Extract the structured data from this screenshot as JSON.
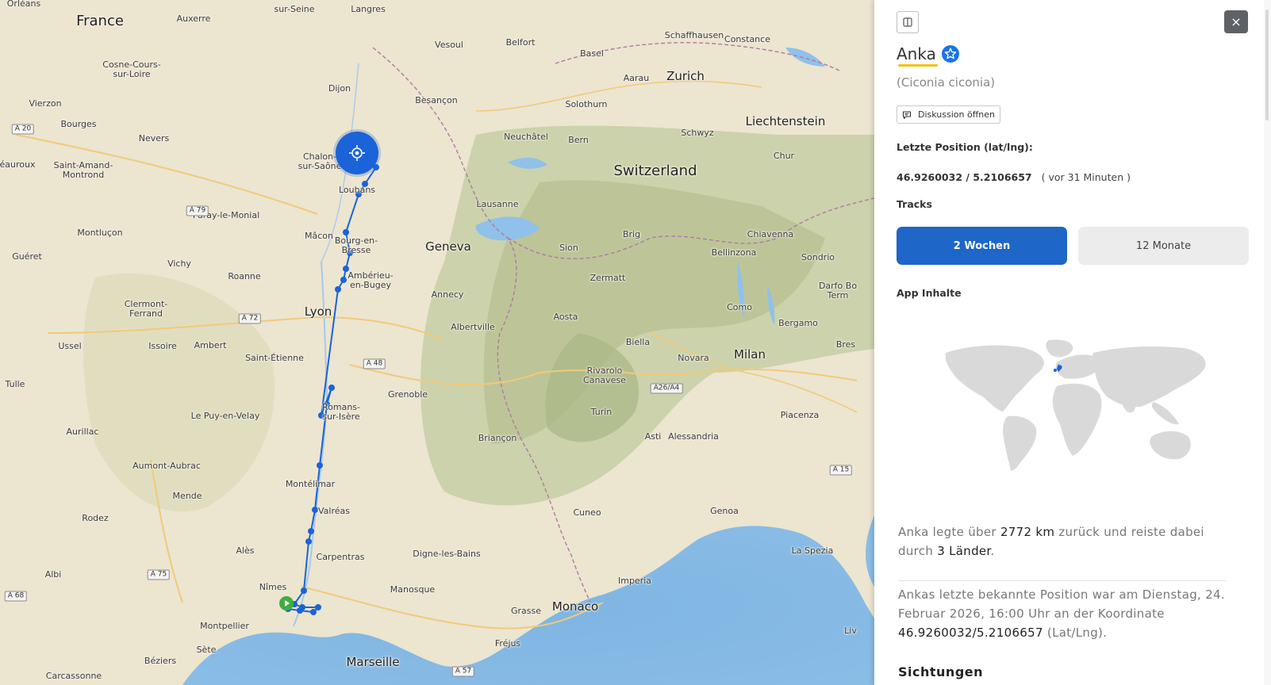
{
  "map": {
    "places": [
      {
        "name": "Orléans",
        "cls": ""
      },
      {
        "name": "France",
        "cls": "big"
      },
      {
        "name": "Auxerre",
        "cls": ""
      },
      {
        "name": "sur-Seine",
        "cls": ""
      },
      {
        "name": "Langres",
        "cls": ""
      },
      {
        "name": "Vesoul",
        "cls": ""
      },
      {
        "name": "Belfort",
        "cls": ""
      },
      {
        "name": "Basel",
        "cls": ""
      },
      {
        "name": "Schaffhausen",
        "cls": ""
      },
      {
        "name": "Constance",
        "cls": ""
      },
      {
        "name": "Zurich",
        "cls": "mid"
      },
      {
        "name": "Aarau",
        "cls": ""
      },
      {
        "name": "Cosne-Cours-\nsur-Loire",
        "cls": ""
      },
      {
        "name": "Dijon",
        "cls": ""
      },
      {
        "name": "Besançon",
        "cls": ""
      },
      {
        "name": "Solothurn",
        "cls": ""
      },
      {
        "name": "Vierzon",
        "cls": ""
      },
      {
        "name": "Bourges",
        "cls": ""
      },
      {
        "name": "Nevers",
        "cls": ""
      },
      {
        "name": "Neuchâtel",
        "cls": ""
      },
      {
        "name": "Bern",
        "cls": ""
      },
      {
        "name": "Schwyz",
        "cls": ""
      },
      {
        "name": "Liechtenstein",
        "cls": "mid"
      },
      {
        "name": "Chalon-\nsur-Saône",
        "cls": ""
      },
      {
        "name": "Saint-Amand-\nMontrond",
        "cls": ""
      },
      {
        "name": "éauroux",
        "cls": ""
      },
      {
        "name": "Louhans",
        "cls": ""
      },
      {
        "name": "Switzerland",
        "cls": "big"
      },
      {
        "name": "Chur",
        "cls": ""
      },
      {
        "name": "Paray-le-Monial",
        "cls": ""
      },
      {
        "name": "Lausanne",
        "cls": ""
      },
      {
        "name": "Montluçon",
        "cls": ""
      },
      {
        "name": "Mâcon",
        "cls": ""
      },
      {
        "name": "Bourg-en-\nBresse",
        "cls": ""
      },
      {
        "name": "Geneva",
        "cls": "mid"
      },
      {
        "name": "Brig",
        "cls": ""
      },
      {
        "name": "Chiavenna",
        "cls": ""
      },
      {
        "name": "Sion",
        "cls": ""
      },
      {
        "name": "Bellinzona",
        "cls": ""
      },
      {
        "name": "Sondrio",
        "cls": ""
      },
      {
        "name": "Guéret",
        "cls": ""
      },
      {
        "name": "Vichy",
        "cls": ""
      },
      {
        "name": "Ambérieu-\nen-Bugey",
        "cls": ""
      },
      {
        "name": "Roanne",
        "cls": ""
      },
      {
        "name": "Zermatt",
        "cls": ""
      },
      {
        "name": "Darfo Bo\nTerm",
        "cls": ""
      },
      {
        "name": "Clermont-\nFerrand",
        "cls": ""
      },
      {
        "name": "Annecy",
        "cls": ""
      },
      {
        "name": "Lyon",
        "cls": "mid"
      },
      {
        "name": "Como",
        "cls": ""
      },
      {
        "name": "Aosta",
        "cls": ""
      },
      {
        "name": "Bergamo",
        "cls": ""
      },
      {
        "name": "Albertville",
        "cls": ""
      },
      {
        "name": "Ussel",
        "cls": ""
      },
      {
        "name": "Issoire",
        "cls": ""
      },
      {
        "name": "Ambert",
        "cls": ""
      },
      {
        "name": "Biella",
        "cls": ""
      },
      {
        "name": "Milan",
        "cls": "mid"
      },
      {
        "name": "Novara",
        "cls": ""
      },
      {
        "name": "Saint-Étienne",
        "cls": ""
      },
      {
        "name": "Bres",
        "cls": ""
      },
      {
        "name": "Rivarolo\nCanavese",
        "cls": ""
      },
      {
        "name": "Tulle",
        "cls": ""
      },
      {
        "name": "Grenoble",
        "cls": ""
      },
      {
        "name": "Romans-\nsur-Isère",
        "cls": ""
      },
      {
        "name": "Le Puy-en-Velay",
        "cls": ""
      },
      {
        "name": "Turin",
        "cls": ""
      },
      {
        "name": "Piacenza",
        "cls": ""
      },
      {
        "name": "Aurillac",
        "cls": ""
      },
      {
        "name": "Briançon",
        "cls": ""
      },
      {
        "name": "Asti",
        "cls": ""
      },
      {
        "name": "Alessandria",
        "cls": ""
      },
      {
        "name": "Aumont-Aubrac",
        "cls": ""
      },
      {
        "name": "Montélimar",
        "cls": ""
      },
      {
        "name": "Mende",
        "cls": ""
      },
      {
        "name": "Valréas",
        "cls": ""
      },
      {
        "name": "Cuneo",
        "cls": ""
      },
      {
        "name": "Genoa",
        "cls": ""
      },
      {
        "name": "Rodez",
        "cls": ""
      },
      {
        "name": "Alès",
        "cls": ""
      },
      {
        "name": "Carpentras",
        "cls": ""
      },
      {
        "name": "Digne-les-Bains",
        "cls": ""
      },
      {
        "name": "La Spezia",
        "cls": ""
      },
      {
        "name": "Albi",
        "cls": ""
      },
      {
        "name": "Imperia",
        "cls": ""
      },
      {
        "name": "Nîmes",
        "cls": ""
      },
      {
        "name": "Manosque",
        "cls": ""
      },
      {
        "name": "Monaco",
        "cls": "mid"
      },
      {
        "name": "Montpellier",
        "cls": ""
      },
      {
        "name": "Grasse",
        "cls": ""
      },
      {
        "name": "Sète",
        "cls": ""
      },
      {
        "name": "Béziers",
        "cls": ""
      },
      {
        "name": "Fréjus",
        "cls": ""
      },
      {
        "name": "Marseille",
        "cls": "mid"
      },
      {
        "name": "Carcassonne",
        "cls": ""
      },
      {
        "name": "Liv",
        "cls": ""
      }
    ],
    "roads": [
      "A 20",
      "A 79",
      "A 72",
      "A 48",
      "A 75",
      "A 68",
      "A 57",
      "A26/A4",
      "A 15"
    ]
  },
  "panel": {
    "animal_name": "Anka",
    "latin_name": "(Ciconia ciconia)",
    "discussion_button": "Diskussion öffnen",
    "last_position_label": "Letzte Position (lat/lng):",
    "last_position_value": "46.9260032 / 5.2106657",
    "last_position_ago": "( vor 31 Minuten )",
    "tracks_label": "Tracks",
    "tracks_options": [
      "2 Wochen",
      "12 Monate"
    ],
    "tracks_selected": "2 Wochen",
    "app_content_label": "App Inhalte",
    "summary": {
      "pre": "Anka legte über ",
      "distance": "2772 km",
      "mid": " zurück und reiste dabei durch ",
      "countries": "3 Länder",
      "post": "."
    },
    "last_known": {
      "pre": "Ankas letzte bekannte Position war am Dienstag, 24. Februar 2026, 16:00 Uhr an der Koordinate ",
      "coord": "46.9260032/5.2106657",
      "post": " (Lat/Lng)."
    },
    "sightings_heading": "Sichtungen"
  },
  "colors": {
    "track": "#1a63d8",
    "accent_button": "#1e66c7",
    "start_marker": "#3fae3f",
    "underline": "#f4c20d"
  }
}
